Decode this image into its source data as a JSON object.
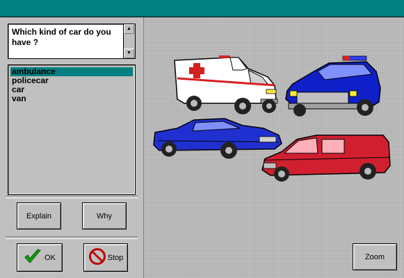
{
  "window": {
    "title": ""
  },
  "question": {
    "text": "Which kind of car do you have ?"
  },
  "scroll": {
    "up_icon": "▲",
    "down_icon": "▼"
  },
  "options": {
    "items": [
      "ambulance",
      "policecar",
      "car",
      "van"
    ],
    "selected": "ambulance"
  },
  "buttons": {
    "explain": "Explain",
    "why": "Why",
    "ok": "OK",
    "stop": "Stop",
    "zoom": "Zoom"
  },
  "icons": {
    "ok": "checkmark-icon",
    "stop": "stop-icon"
  },
  "colors": {
    "titlebar": "#008080",
    "selection": "#008080",
    "ambulance_cross": "#d42020",
    "police": "#1020c8",
    "sedan": "#2030d0",
    "van": "#d02030"
  }
}
